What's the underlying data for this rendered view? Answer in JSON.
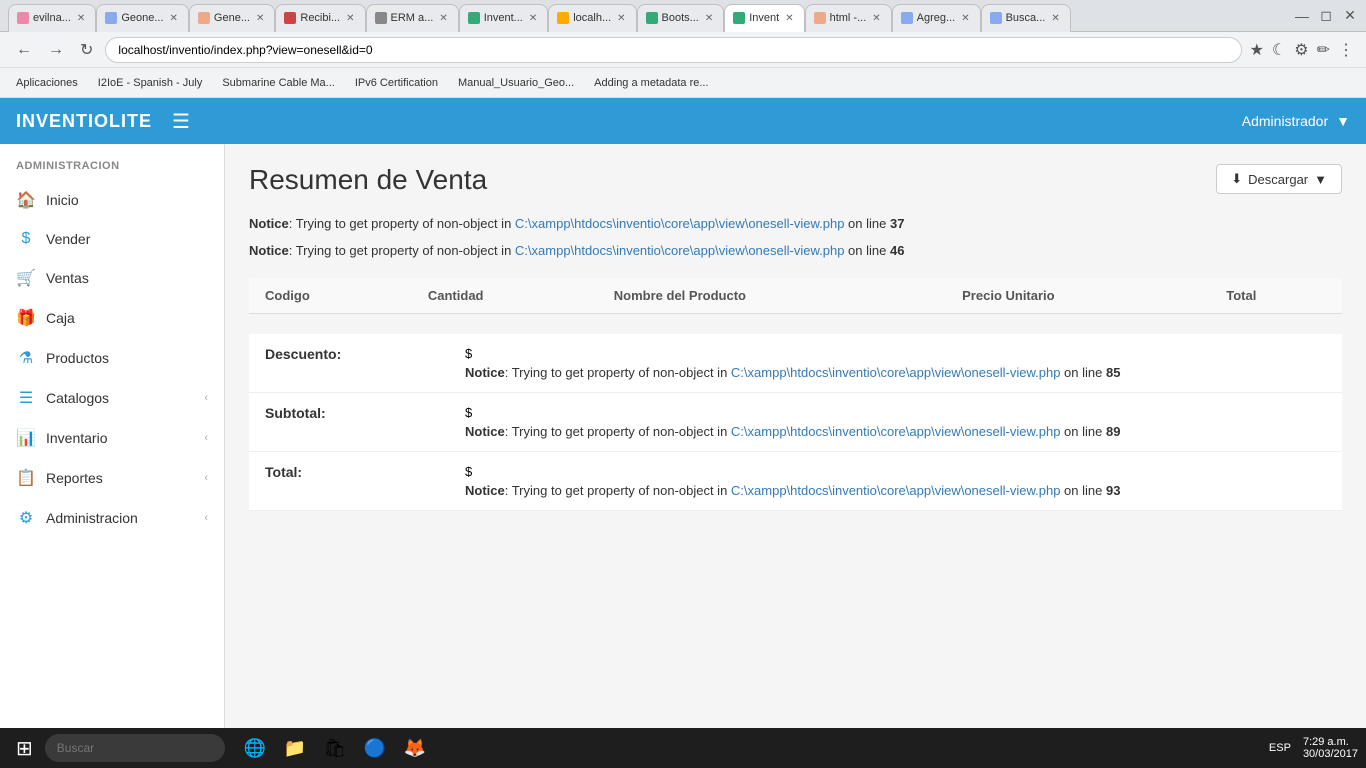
{
  "browser": {
    "tabs": [
      {
        "id": "tab1",
        "label": "evilna...",
        "icon_color": "#e8a",
        "active": false
      },
      {
        "id": "tab2",
        "label": "Geone...",
        "icon_color": "#8ae",
        "active": false
      },
      {
        "id": "tab3",
        "label": "Gene...",
        "icon_color": "#ea8",
        "active": false
      },
      {
        "id": "tab4",
        "label": "Recibi...",
        "icon_color": "#c44",
        "active": false
      },
      {
        "id": "tab5",
        "label": "ERM a...",
        "icon_color": "#888",
        "active": false
      },
      {
        "id": "tab6",
        "label": "Invent...",
        "icon_color": "#3a7",
        "active": false
      },
      {
        "id": "tab7",
        "label": "localh...",
        "icon_color": "#fa0",
        "active": false
      },
      {
        "id": "tab8",
        "label": "Boots...",
        "icon_color": "#3a7",
        "active": false
      },
      {
        "id": "tab9",
        "label": "Invent",
        "icon_color": "#3a7",
        "active": true
      },
      {
        "id": "tab10",
        "label": "html -...",
        "icon_color": "#ea8",
        "active": false
      },
      {
        "id": "tab11",
        "label": "Agreg...",
        "icon_color": "#8ae",
        "active": false
      },
      {
        "id": "tab12",
        "label": "Busca...",
        "icon_color": "#8ae",
        "active": false
      }
    ],
    "url": "localhost/inventio/index.php?view=onesell&id=0",
    "bookmarks": [
      {
        "label": "Aplicaciones"
      },
      {
        "label": "I2IoE - Spanish - July"
      },
      {
        "label": "Submarine Cable Ma..."
      },
      {
        "label": "IPv6 Certification"
      },
      {
        "label": "Manual_Usuario_Geo..."
      },
      {
        "label": "Adding a metadata re..."
      }
    ]
  },
  "topnav": {
    "logo": "INVENTIOLITE",
    "admin_label": "Administrador"
  },
  "sidebar": {
    "section_label": "ADMINISTRACION",
    "items": [
      {
        "icon": "🏠",
        "label": "Inicio",
        "has_arrow": false
      },
      {
        "icon": "$",
        "label": "Vender",
        "has_arrow": false
      },
      {
        "icon": "🛒",
        "label": "Ventas",
        "has_arrow": false
      },
      {
        "icon": "🎁",
        "label": "Caja",
        "has_arrow": false
      },
      {
        "icon": "⚗",
        "label": "Productos",
        "has_arrow": false
      },
      {
        "icon": "☰",
        "label": "Catalogos",
        "has_arrow": true
      },
      {
        "icon": "📊",
        "label": "Inventario",
        "has_arrow": true
      },
      {
        "icon": "📋",
        "label": "Reportes",
        "has_arrow": true
      },
      {
        "icon": "⚙",
        "label": "Administracion",
        "has_arrow": true
      }
    ]
  },
  "main": {
    "page_title": "Resumen de Venta",
    "download_btn": "Descargar",
    "notices": [
      {
        "label": "Notice",
        "text": ": Trying to get property of non-object in ",
        "path": "C:\\xampp\\htdocs\\inventio\\core\\app\\view\\onesell-view.php",
        "line_text": " on line ",
        "line_num": "37"
      },
      {
        "label": "Notice",
        "text": ": Trying to get property of non-object in ",
        "path": "C:\\xampp\\htdocs\\inventio\\core\\app\\view\\onesell-view.php",
        "line_text": " on line ",
        "line_num": "46"
      }
    ],
    "table": {
      "columns": [
        "Codigo",
        "Cantidad",
        "Nombre del Producto",
        "Precio Unitario",
        "Total"
      ],
      "rows": []
    },
    "summary": [
      {
        "label": "Descuento:",
        "dollar": "$",
        "notice_label": "Notice",
        "notice_text": ": Trying to get property of non-object in ",
        "notice_path": "C:\\xampp\\htdocs\\inventio\\core\\app\\view\\onesell-view.php",
        "notice_line_text": " on line ",
        "notice_line_num": "85"
      },
      {
        "label": "Subtotal:",
        "dollar": "$",
        "notice_label": "Notice",
        "notice_text": ": Trying to get property of non-object in ",
        "notice_path": "C:\\xampp\\htdocs\\inventio\\core\\app\\view\\onesell-view.php",
        "notice_line_text": " on line ",
        "notice_line_num": "89"
      },
      {
        "label": "Total:",
        "dollar": "$",
        "notice_label": "Notice",
        "notice_text": ": Trying to get property of non-object in ",
        "notice_path": "C:\\xampp\\htdocs\\inventio\\core\\app\\view\\onesell-view.php",
        "notice_line_text": " on line ",
        "notice_line_num": "93"
      }
    ]
  },
  "taskbar": {
    "time": "7:29 a.m.",
    "date": "30/03/2017",
    "lang": "ESP",
    "search_placeholder": "Buscar"
  }
}
